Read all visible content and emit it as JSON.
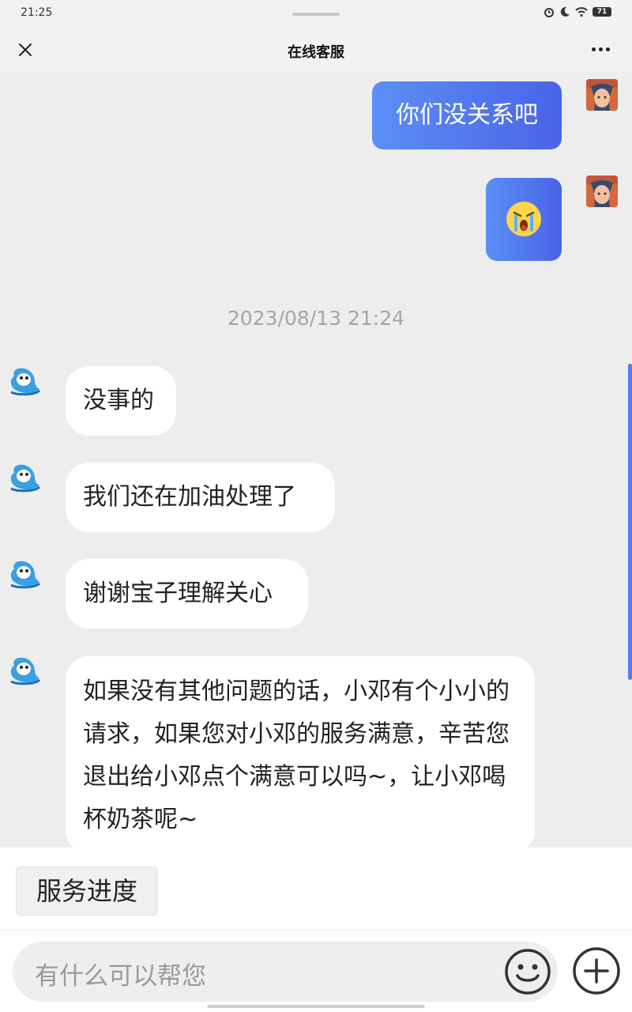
{
  "status_bar": {
    "time": "21:25",
    "battery": "71"
  },
  "header": {
    "title": "在线客服"
  },
  "messages": {
    "out1": "你们没关系吧",
    "out2_icon": "crying-face-emoji",
    "timestamp": "2023/08/13 21:24",
    "in1": "没事的",
    "in2": "我们还在加油处理了",
    "in3": "谢谢宝子理解关心",
    "in4": "如果没有其他问题的话，小邓有个小小的请求，如果您对小邓的服务满意，辛苦您退出给小邓点个满意可以吗~，让小邓喝杯奶茶呢~"
  },
  "quick_actions": {
    "service_progress": "服务进度"
  },
  "input": {
    "placeholder": "有什么可以帮您"
  },
  "colors": {
    "bubble_gradient_start": "#5b8ff4",
    "bubble_gradient_end": "#4a63e8",
    "background": "#ededed",
    "scrollbar": "#4f7df2"
  }
}
